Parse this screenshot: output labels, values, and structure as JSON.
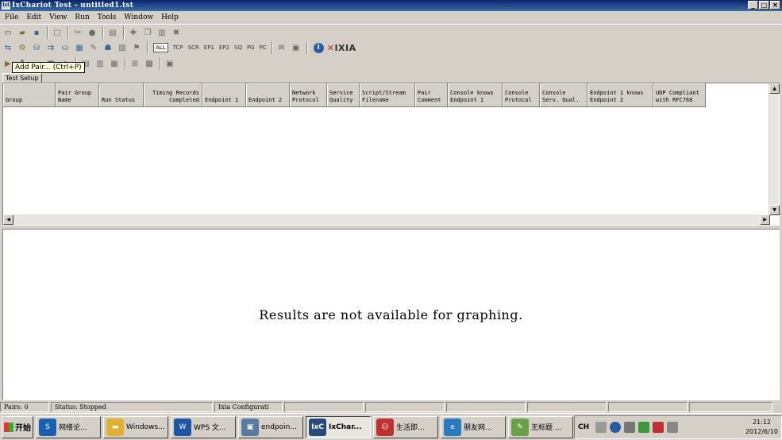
{
  "window": {
    "title": "IxChariot Test - untitled1.tst",
    "app_icon": "IxC"
  },
  "menu": [
    "File",
    "Edit",
    "View",
    "Run",
    "Tools",
    "Window",
    "Help"
  ],
  "toolbar": {
    "protocols": [
      "ALL",
      "TCP",
      "SCR",
      "EP1",
      "EP2",
      "SQ",
      "PG",
      "PC"
    ],
    "selected_protocol": "ALL",
    "brand": "IXIA"
  },
  "tooltip": "Add Pair... (Ctrl+P)",
  "tab": {
    "label": "Test Setup"
  },
  "grid": {
    "columns": [
      "Group",
      "Pair Group\nName",
      "Run Status",
      "Timing Records\nCompleted",
      "Endpoint 1",
      "Endpoint 2",
      "Network\nProtocol",
      "Service\nQuality",
      "Script/Stream\nFilename",
      "Pair\nComment",
      "Console knows\nEndpoint 1",
      "Console\nProtocol",
      "Console\nServ. Qual.",
      "Endpoint 1 knows\nEndpoint 2",
      "UDP Compliant\nwith RFC768"
    ]
  },
  "results": {
    "message": "Results are not available for graphing."
  },
  "status": {
    "pairs": "Pairs: 0",
    "status": "Status: Stopped",
    "config": "Ixia Configurati"
  },
  "taskbar": {
    "start": "开始",
    "tasks": [
      "网络论...",
      "Windows...",
      "WPS 文...",
      "endpoin...",
      "IxChar...",
      "生活即...",
      "朋友网...",
      "无标题 ..."
    ],
    "active_index": 4,
    "lang": "CH",
    "time": "21:12",
    "date": "2012/6/10"
  },
  "colors": {
    "titlebar": "#0a246a",
    "accent_red": "#c0202a",
    "face": "#d4d0c8"
  }
}
